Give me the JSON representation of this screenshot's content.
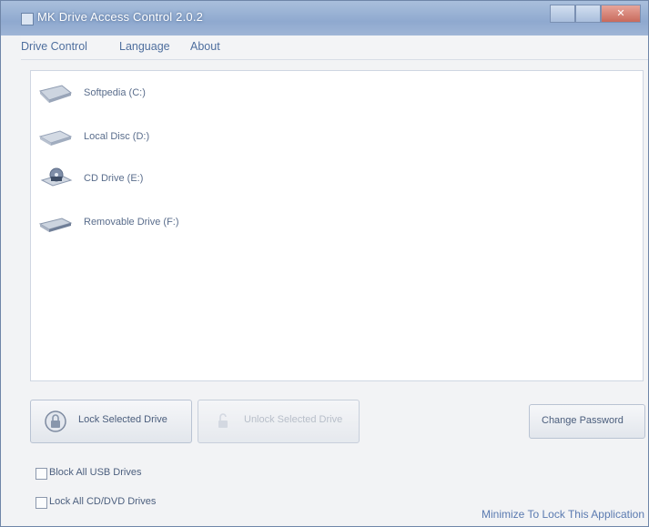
{
  "window": {
    "title": "MK Drive Access Control 2.0.2"
  },
  "menu": [
    "Drive Control",
    "Language",
    "About"
  ],
  "drives": [
    {
      "label": "Softpedia (C:)",
      "icon": "hard-drive-icon"
    },
    {
      "label": "Local Disc (D:)",
      "icon": "hard-drive-icon"
    },
    {
      "label": "CD Drive (E:)",
      "icon": "cd-drive-icon"
    },
    {
      "label": "Removable Drive (F:)",
      "icon": "removable-drive-icon"
    }
  ],
  "buttons": {
    "lock": "Lock Selected Drive",
    "unlock": "Unlock Selected Drive",
    "change_password": "Change Password"
  },
  "options": {
    "block_usb": {
      "label": "Block All USB Drives",
      "checked": false
    },
    "lock_cd": {
      "label": "Lock All CD/DVD Drives",
      "checked": false
    }
  },
  "status": {
    "minimize_text": "Minimize To Lock This Application"
  }
}
